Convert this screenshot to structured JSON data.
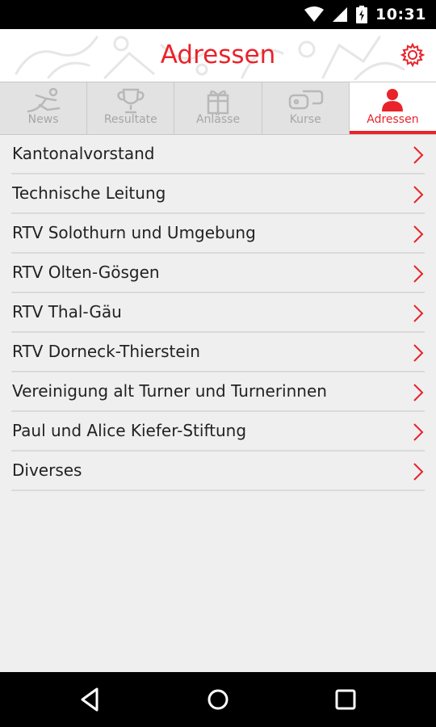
{
  "status_bar": {
    "time": "10:31"
  },
  "header": {
    "title": "Adressen",
    "accent": "#e8232a"
  },
  "tabs": [
    {
      "label": "News",
      "icon": "runner-icon",
      "active": false
    },
    {
      "label": "Resultate",
      "icon": "trophy-icon",
      "active": false
    },
    {
      "label": "Anlässe",
      "icon": "gift-icon",
      "active": false
    },
    {
      "label": "Kurse",
      "icon": "chat-icon",
      "active": false
    },
    {
      "label": "Adressen",
      "icon": "person-icon",
      "active": true
    }
  ],
  "list": [
    {
      "label": "Kantonalvorstand"
    },
    {
      "label": "Technische Leitung"
    },
    {
      "label": "RTV Solothurn und Umgebung"
    },
    {
      "label": "RTV Olten-Gösgen"
    },
    {
      "label": "RTV Thal-Gäu"
    },
    {
      "label": "RTV Dorneck-Thierstein"
    },
    {
      "label": "Vereinigung alt Turner und Turnerinnen"
    },
    {
      "label": "Paul und Alice Kiefer-Stiftung"
    },
    {
      "label": "Diverses"
    }
  ]
}
